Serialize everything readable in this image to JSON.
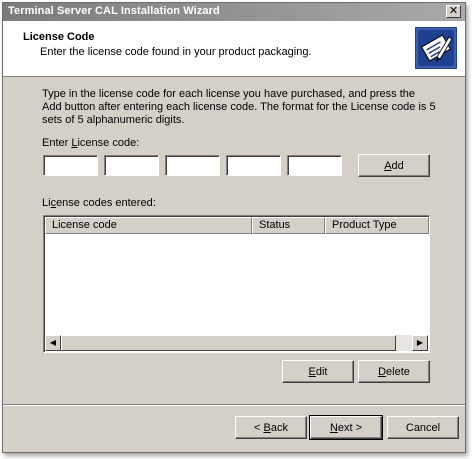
{
  "window": {
    "title": "Terminal Server CAL Installation Wizard",
    "close_glyph": "✕"
  },
  "header": {
    "title": "License Code",
    "subtitle": "Enter the license code found in your product packaging.",
    "icon": "license-wizard-icon"
  },
  "main": {
    "description": "Type in the license code for each license you have purchased, and press the Add button after entering each license code. The format for the License code is 5 sets of 5 alphanumeric digits.",
    "enter_label_pre": "Enter ",
    "enter_label_accel": "L",
    "enter_label_post": "icense code:",
    "code_fields": [
      "",
      "",
      "",
      "",
      ""
    ],
    "add_accel": "A",
    "add_rest": "dd",
    "entered_label_pre": "Li",
    "entered_label_accel": "c",
    "entered_label_post": "ense codes entered:",
    "columns": [
      "License code",
      "Status",
      "Product Type"
    ],
    "rows": [],
    "edit_accel": "E",
    "edit_rest": "dit",
    "delete_accel": "D",
    "delete_rest": "elete"
  },
  "footer": {
    "back_arrow": "< ",
    "back_accel": "B",
    "back_rest": "ack",
    "next_accel": "N",
    "next_rest": "ext >",
    "cancel_label": "Cancel"
  }
}
